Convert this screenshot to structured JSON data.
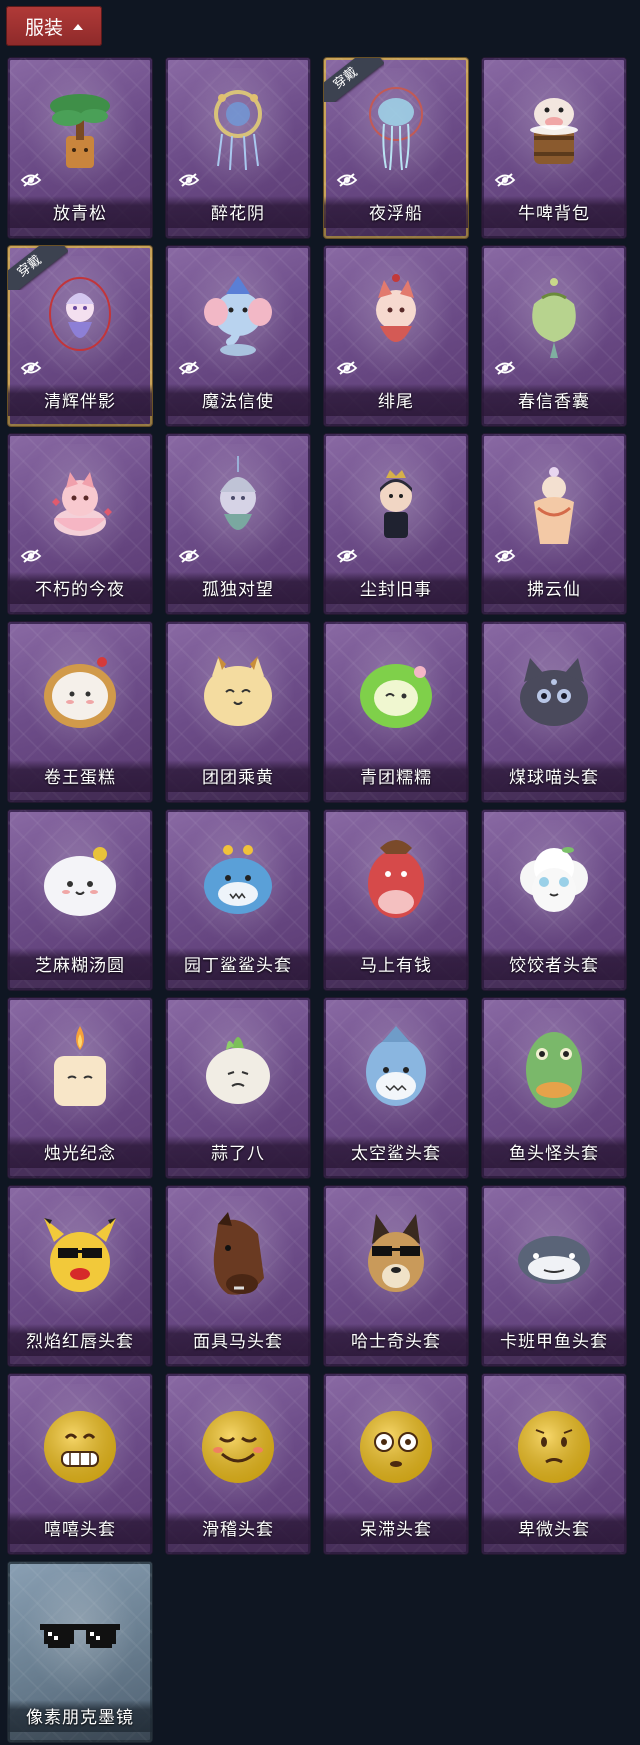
{
  "section": {
    "title": "服装"
  },
  "badge_text": "穿戴",
  "items": [
    {
      "name": "放青松",
      "icon": "pine-bonsai-icon",
      "hidden": true,
      "equipped": false
    },
    {
      "name": "醉花阴",
      "icon": "dreamcatcher-icon",
      "hidden": true,
      "equipped": false
    },
    {
      "name": "夜浮船",
      "icon": "jellyfish-ornament-icon",
      "hidden": true,
      "equipped": true
    },
    {
      "name": "牛啤背包",
      "icon": "cow-barrel-icon",
      "hidden": true,
      "equipped": false
    },
    {
      "name": "清辉伴影",
      "icon": "fox-girl-charm-icon",
      "hidden": true,
      "equipped": true
    },
    {
      "name": "魔法信使",
      "icon": "elephant-plush-icon",
      "hidden": true,
      "equipped": false
    },
    {
      "name": "绯尾",
      "icon": "fox-doll-charm-icon",
      "hidden": true,
      "equipped": false
    },
    {
      "name": "春信香囊",
      "icon": "sachet-icon",
      "hidden": true,
      "equipped": false
    },
    {
      "name": "不朽的今夜",
      "icon": "fox-bowl-icon",
      "hidden": true,
      "equipped": false
    },
    {
      "name": "孤独对望",
      "icon": "moon-figure-charm-icon",
      "hidden": true,
      "equipped": false
    },
    {
      "name": "尘封旧事",
      "icon": "chibi-prince-charm-icon",
      "hidden": true,
      "equipped": false
    },
    {
      "name": "拂云仙",
      "icon": "immortal-charm-icon",
      "hidden": true,
      "equipped": false
    },
    {
      "name": "卷王蛋糕",
      "icon": "roll-cake-head-icon",
      "hidden": false,
      "equipped": false
    },
    {
      "name": "团团乘黄",
      "icon": "cat-bun-head-icon",
      "hidden": false,
      "equipped": false
    },
    {
      "name": "青团糯糯",
      "icon": "green-dumpling-head-icon",
      "hidden": false,
      "equipped": false
    },
    {
      "name": "煤球喵头套",
      "icon": "black-cat-head-icon",
      "hidden": false,
      "equipped": false
    },
    {
      "name": "芝麻糊汤圆",
      "icon": "tangyuan-head-icon",
      "hidden": false,
      "equipped": false
    },
    {
      "name": "园丁鲨鲨头套",
      "icon": "blue-shark-head-icon",
      "hidden": false,
      "equipped": false
    },
    {
      "name": "马上有钱",
      "icon": "red-horse-head-icon",
      "hidden": false,
      "equipped": false
    },
    {
      "name": "饺饺者头套",
      "icon": "dumpling-cloud-head-icon",
      "hidden": false,
      "equipped": false
    },
    {
      "name": "烛光纪念",
      "icon": "candle-head-icon",
      "hidden": false,
      "equipped": false
    },
    {
      "name": "蒜了八",
      "icon": "garlic-head-icon",
      "hidden": false,
      "equipped": false
    },
    {
      "name": "太空鲨头套",
      "icon": "space-shark-head-icon",
      "hidden": false,
      "equipped": false
    },
    {
      "name": "鱼头怪头套",
      "icon": "fish-monster-head-icon",
      "hidden": false,
      "equipped": false
    },
    {
      "name": "烈焰红唇头套",
      "icon": "pikachu-lips-head-icon",
      "hidden": false,
      "equipped": false
    },
    {
      "name": "面具马头套",
      "icon": "horse-mask-head-icon",
      "hidden": false,
      "equipped": false
    },
    {
      "name": "哈士奇头套",
      "icon": "husky-head-icon",
      "hidden": false,
      "equipped": false
    },
    {
      "name": "卡班甲鱼头套",
      "icon": "catfish-head-icon",
      "hidden": false,
      "equipped": false
    },
    {
      "name": "嘻嘻头套",
      "icon": "grin-emoji-head-icon",
      "hidden": false,
      "equipped": false
    },
    {
      "name": "滑稽头套",
      "icon": "funny-emoji-head-icon",
      "hidden": false,
      "equipped": false
    },
    {
      "name": "呆滞头套",
      "icon": "dazed-emoji-head-icon",
      "hidden": false,
      "equipped": false
    },
    {
      "name": "卑微头套",
      "icon": "humble-emoji-head-icon",
      "hidden": false,
      "equipped": false
    },
    {
      "name": "像素朋克墨镜",
      "icon": "pixel-sunglasses-icon",
      "hidden": false,
      "equipped": false,
      "special": true
    }
  ],
  "colors": {
    "background": "#0f1622",
    "header": "#b13a38",
    "card_purple": "#6d4d89",
    "card_special": "#6b8092",
    "equipped_border": "#c8a35a"
  }
}
